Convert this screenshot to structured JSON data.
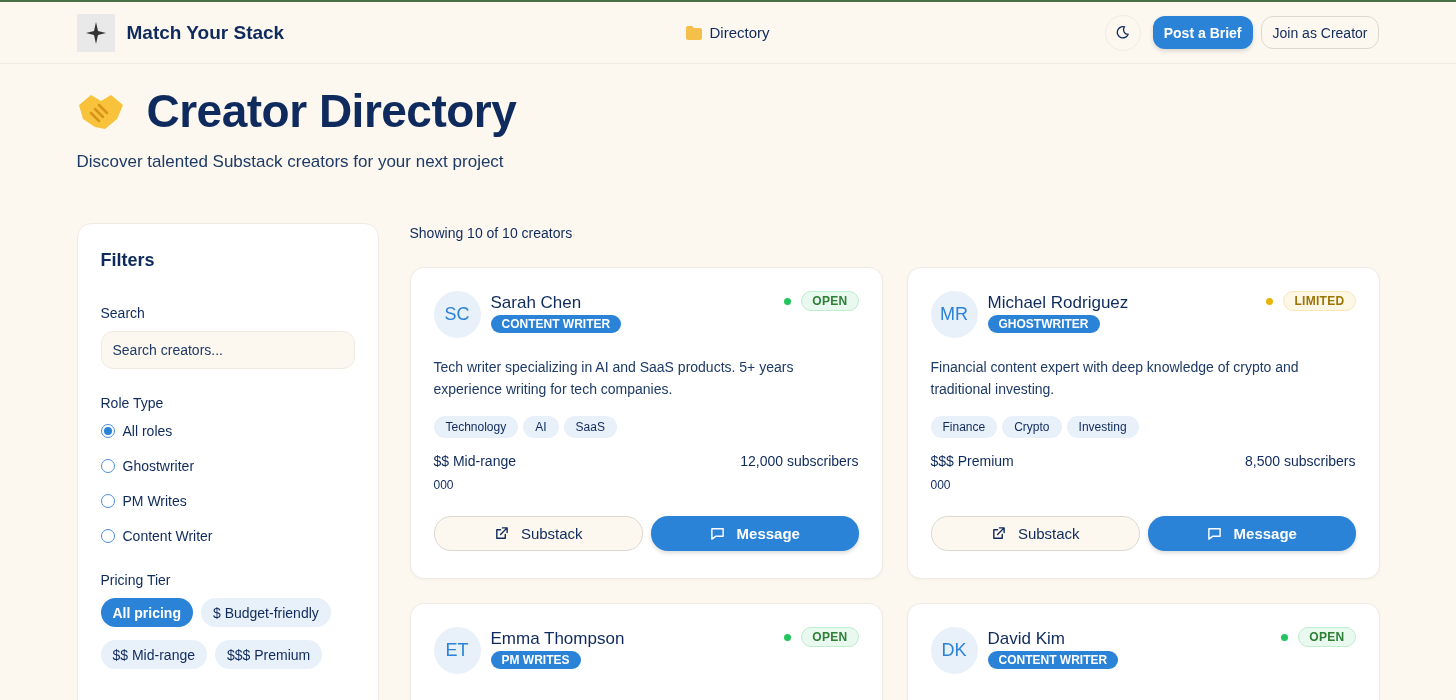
{
  "header": {
    "brand": "Match Your Stack",
    "nav": [
      {
        "label": "Directory"
      }
    ],
    "buttons": [
      {
        "label": "Post a Brief",
        "kind": "primary"
      },
      {
        "label": "Join as Creator",
        "kind": "outline"
      }
    ]
  },
  "hero": {
    "title": "Creator Directory",
    "subtitle": "Discover talented Substack creators for your next project"
  },
  "filters": {
    "title": "Filters",
    "search": {
      "label": "Search",
      "placeholder": "Search creators..."
    },
    "role_type": {
      "label": "Role Type",
      "options": [
        {
          "label": "All roles",
          "selected": true
        },
        {
          "label": "Ghostwriter",
          "selected": false
        },
        {
          "label": "PM Writes",
          "selected": false
        },
        {
          "label": "Content Writer",
          "selected": false
        }
      ]
    },
    "pricing": {
      "label": "Pricing Tier",
      "options": [
        {
          "label": "All pricing",
          "selected": true
        },
        {
          "label": "$ Budget-friendly",
          "selected": false
        },
        {
          "label": "$$ Mid-range",
          "selected": false
        },
        {
          "label": "$$$ Premium",
          "selected": false
        }
      ]
    }
  },
  "results": {
    "count": "Showing 10 of 10 creators",
    "creators": [
      {
        "initials": "SC",
        "name": "Sarah Chen",
        "role": "CONTENT WRITER",
        "status": "OPEN",
        "color": "#22c55e",
        "bio": "Tech writer specializing in AI and SaaS products. 5+ years experience writing for tech companies.",
        "tags": [
          "Technology",
          "AI",
          "SaaS"
        ],
        "price": "$$ Mid-range",
        "subscribers": "12,000 subscribers",
        "extra": "000",
        "links": [
          "Substack",
          "Message"
        ]
      },
      {
        "initials": "MR",
        "name": "Michael Rodriguez",
        "role": "GHOSTWRITER",
        "status": "LIMITED",
        "color": "#eab308",
        "bio": "Financial content expert with deep knowledge of crypto and traditional investing.",
        "tags": [
          "Finance",
          "Crypto",
          "Investing"
        ],
        "price": "$$$ Premium",
        "subscribers": "8,500 subscribers",
        "extra": "000",
        "links": [
          "Substack",
          "Message"
        ]
      },
      {
        "initials": "ET",
        "name": "Emma Thompson",
        "role": "PM WRITES",
        "status": "OPEN",
        "color": "#22c55e"
      },
      {
        "initials": "DK",
        "name": "David Kim",
        "role": "CONTENT WRITER",
        "status": "OPEN",
        "color": "#22c55e"
      }
    ]
  }
}
